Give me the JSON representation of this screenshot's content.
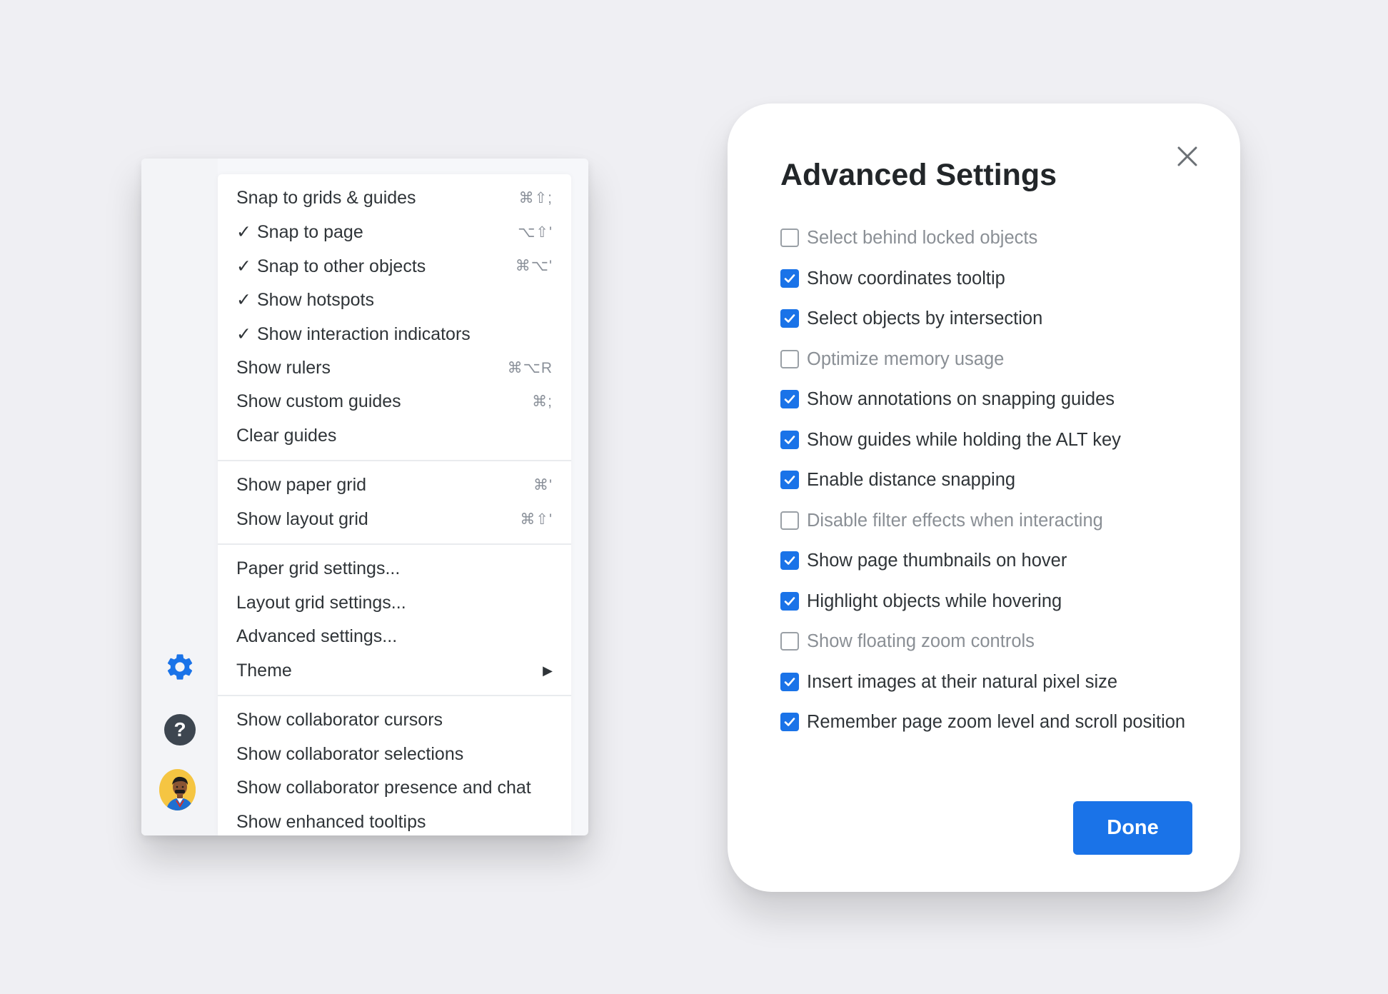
{
  "menu": {
    "sections": [
      [
        {
          "label": "Snap to grids & guides",
          "checked": false,
          "shortcut": "⌘⇧;"
        },
        {
          "label": "Snap to page",
          "checked": true,
          "shortcut": "⌥⇧'"
        },
        {
          "label": "Snap to other objects",
          "checked": true,
          "shortcut": "⌘⌥'"
        },
        {
          "label": "Show hotspots",
          "checked": true,
          "shortcut": ""
        },
        {
          "label": "Show interaction indicators",
          "checked": true,
          "shortcut": ""
        },
        {
          "label": "Show rulers",
          "checked": false,
          "shortcut": "⌘⌥R"
        },
        {
          "label": "Show custom guides",
          "checked": false,
          "shortcut": "⌘;"
        },
        {
          "label": "Clear guides",
          "checked": false,
          "shortcut": ""
        }
      ],
      [
        {
          "label": "Show paper grid",
          "checked": false,
          "shortcut": "⌘'"
        },
        {
          "label": "Show layout grid",
          "checked": false,
          "shortcut": "⌘⇧'"
        }
      ],
      [
        {
          "label": "Paper grid settings...",
          "checked": false,
          "shortcut": ""
        },
        {
          "label": "Layout grid settings...",
          "checked": false,
          "shortcut": ""
        },
        {
          "label": "Advanced settings...",
          "checked": false,
          "shortcut": ""
        },
        {
          "label": "Theme",
          "checked": false,
          "shortcut": "",
          "submenu": true
        }
      ],
      [
        {
          "label": "Show collaborator cursors",
          "checked": false,
          "shortcut": ""
        },
        {
          "label": "Show collaborator selections",
          "checked": false,
          "shortcut": ""
        },
        {
          "label": "Show collaborator presence and chat",
          "checked": false,
          "shortcut": ""
        },
        {
          "label": "Show enhanced tooltips",
          "checked": false,
          "shortcut": ""
        }
      ]
    ],
    "check_glyph": "✓",
    "submenu_glyph": "▶"
  },
  "rail": {
    "icons": [
      "gear-icon",
      "help-icon",
      "avatar"
    ],
    "help_glyph": "?",
    "accent": "#1a73e8"
  },
  "dialog": {
    "title": "Advanced Settings",
    "options": [
      {
        "label": "Select behind locked objects",
        "checked": false
      },
      {
        "label": "Show coordinates tooltip",
        "checked": true
      },
      {
        "label": "Select objects by intersection",
        "checked": true
      },
      {
        "label": "Optimize memory usage",
        "checked": false
      },
      {
        "label": "Show annotations on snapping guides",
        "checked": true
      },
      {
        "label": "Show guides while holding the ALT key",
        "checked": true
      },
      {
        "label": "Enable distance snapping",
        "checked": true
      },
      {
        "label": "Disable filter effects when interacting",
        "checked": false
      },
      {
        "label": "Show page thumbnails on hover",
        "checked": true
      },
      {
        "label": "Highlight objects while hovering",
        "checked": true
      },
      {
        "label": "Show floating zoom controls",
        "checked": false
      },
      {
        "label": "Insert images at their natural pixel size",
        "checked": true
      },
      {
        "label": "Remember page zoom level and scroll position",
        "checked": true
      }
    ],
    "done_label": "Done",
    "accent": "#1a73e8"
  }
}
